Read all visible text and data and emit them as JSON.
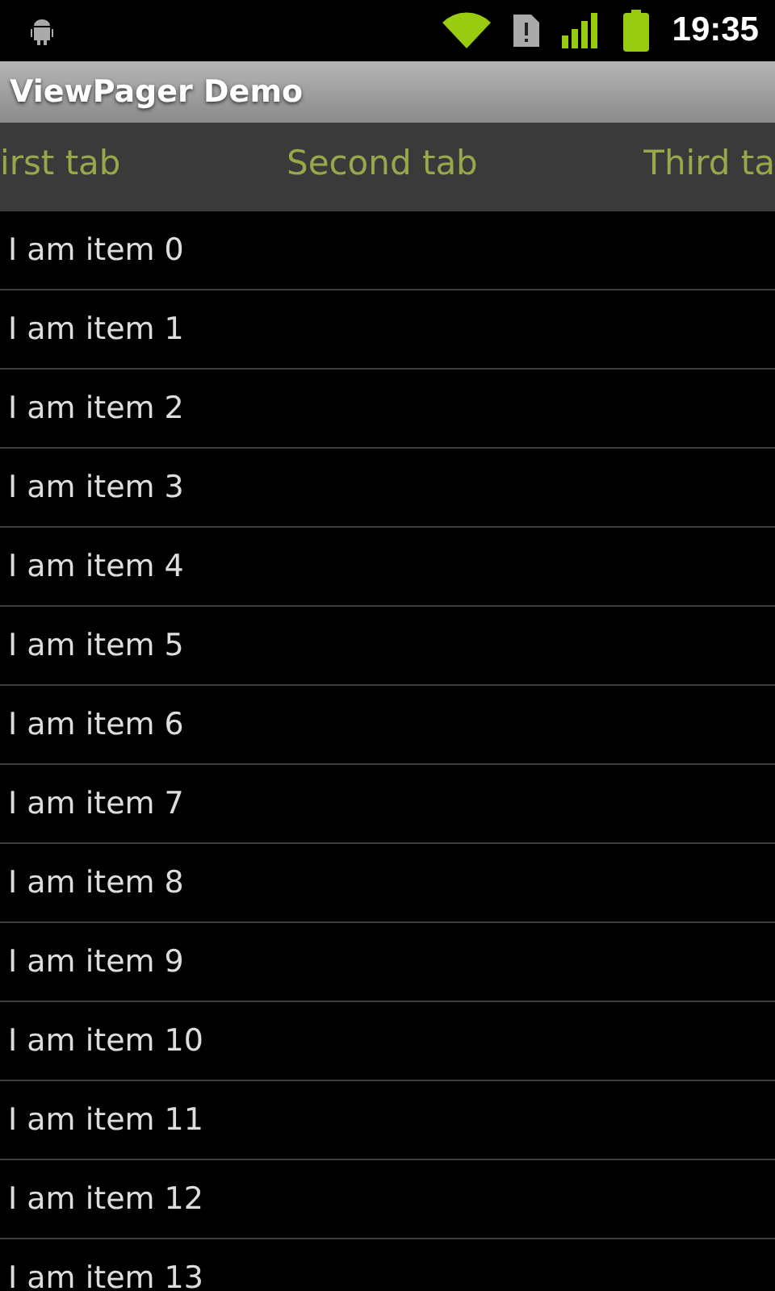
{
  "status_bar": {
    "time": "19:35"
  },
  "window": {
    "title": "ViewPager Demo"
  },
  "tabs": [
    {
      "label": "irst tab"
    },
    {
      "label": "Second tab"
    },
    {
      "label": "Third ta"
    }
  ],
  "list": {
    "items": [
      "I am item 0",
      "I am item 1",
      "I am item 2",
      "I am item 3",
      "I am item 4",
      "I am item 5",
      "I am item 6",
      "I am item 7",
      "I am item 8",
      "I am item 9",
      "I am item 10",
      "I am item 11",
      "I am item 12",
      "I am item 13"
    ]
  }
}
